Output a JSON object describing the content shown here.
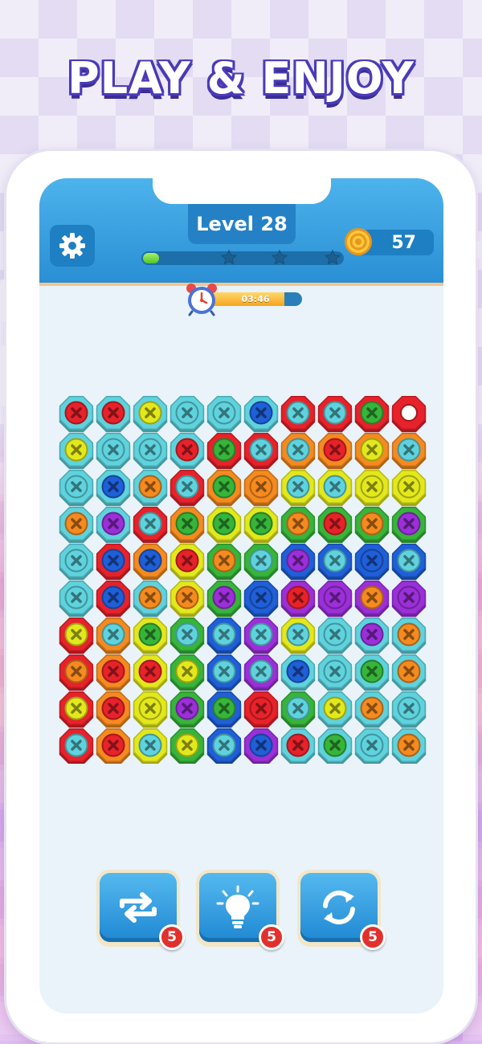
{
  "headline": "PLAY & ENJOY",
  "header": {
    "level_label": "Level 28",
    "coins": "57",
    "level_progress": 0.08,
    "progress_stars": 3
  },
  "timer": {
    "text": "03:46",
    "remaining_fraction": 0.82
  },
  "board": {
    "rows": 10,
    "cols": 10,
    "colors": {
      "R": "#e8222a",
      "O": "#f58a1f",
      "Y": "#e3e81c",
      "G": "#37b43a",
      "T": "#5fd3dd",
      "B": "#1f5fd8",
      "P": "#9b2fd8"
    },
    "pieces": [
      "T/R T/R T/Y T/T T/T T/B R/T R/T R/G R/_",
      "T/Y T/T T/T T/R R/G R/T O/T O/R O/Y O/T",
      "T/T T/B T/O R/T O/G O/O Y/T Y/T Y/Y Y/Y",
      "T/O T/P R/T O/G Y/G Y/G G/O G/R G/O G/P",
      "T/T R/B O/B Y/R G/O G/T B/P B/T B/B B/T",
      "T/T R/B T/O Y/O G/P B/B P/R P/P P/O P/P",
      "R/Y O/T Y/G G/T B/T P/T Y/T T/T T/P T/O",
      "R/O O/R Y/R G/Y B/T P/T T/B T/T T/G T/O",
      "R/Y O/R Y/Y G/P B/G R/R G/T T/Y T/O T/T",
      "R/T O/R Y/T G/Y B/T P/B T/R T/G T/T T/O"
    ]
  },
  "tools": [
    {
      "name": "swap",
      "count": "5"
    },
    {
      "name": "hint",
      "count": "5"
    },
    {
      "name": "shuffle",
      "count": "5"
    }
  ]
}
